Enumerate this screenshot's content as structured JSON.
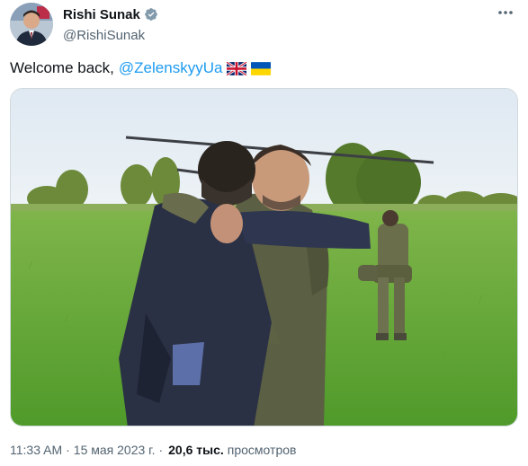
{
  "tweet": {
    "author": {
      "display_name": "Rishi Sunak",
      "handle": "@RishiSunak",
      "verified": true
    },
    "text_prefix": "Welcome back,",
    "mention": "@ZelenskyyUa",
    "flags": [
      "uk-flag",
      "ukraine-flag"
    ],
    "time": "11:33 AM",
    "separator": "·",
    "date": "15 мая 2023 г.",
    "views_count": "20,6 тыс.",
    "views_label": "просмотров"
  },
  "colors": {
    "link": "#1d9bf0",
    "secondary_text": "#536471",
    "primary_text": "#0f1419"
  }
}
